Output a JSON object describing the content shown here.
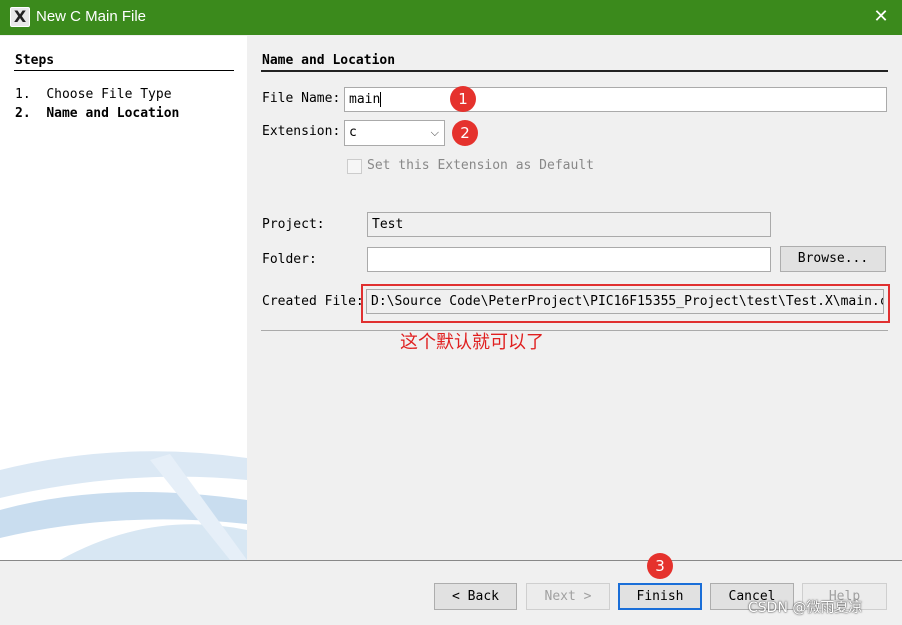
{
  "window": {
    "title": "New C Main File",
    "app_icon": "X",
    "close_glyph": "✕",
    "icons": {
      "app": "mplab-x-icon",
      "close": "close-icon"
    }
  },
  "steps": {
    "title": "Steps",
    "items": [
      {
        "number": "1.",
        "label": "Choose File Type",
        "current": false
      },
      {
        "number": "2.",
        "label": "Name and Location",
        "current": true
      }
    ]
  },
  "panel": {
    "title": "Name and Location",
    "file_name_label": "File Name:",
    "file_name_value": "main",
    "extension_label": "Extension:",
    "extension_value": "c",
    "default_checkbox_label": "Set this Extension as Default",
    "default_checked": false,
    "project_label": "Project:",
    "project_value": "Test",
    "folder_label": "Folder:",
    "folder_value": "",
    "browse_label": "Browse...",
    "created_file_label": "Created File:",
    "created_file_value": "D:\\Source Code\\PeterProject\\PIC16F15355_Project\\test\\Test.X\\main.c"
  },
  "annotations": {
    "badges": [
      "1",
      "2",
      "3"
    ],
    "note": "这个默认就可以了",
    "note_color": "#e02020",
    "badge_color": "#e5322d"
  },
  "footer": {
    "back_label": "< Back",
    "next_label": "Next >",
    "finish_label": "Finish",
    "cancel_label": "Cancel",
    "help_label": "Help"
  },
  "watermark": "CSDN @微雨夏凉",
  "colors": {
    "titlebar": "#3b8a1c",
    "focus_border": "#1a6ed8"
  }
}
